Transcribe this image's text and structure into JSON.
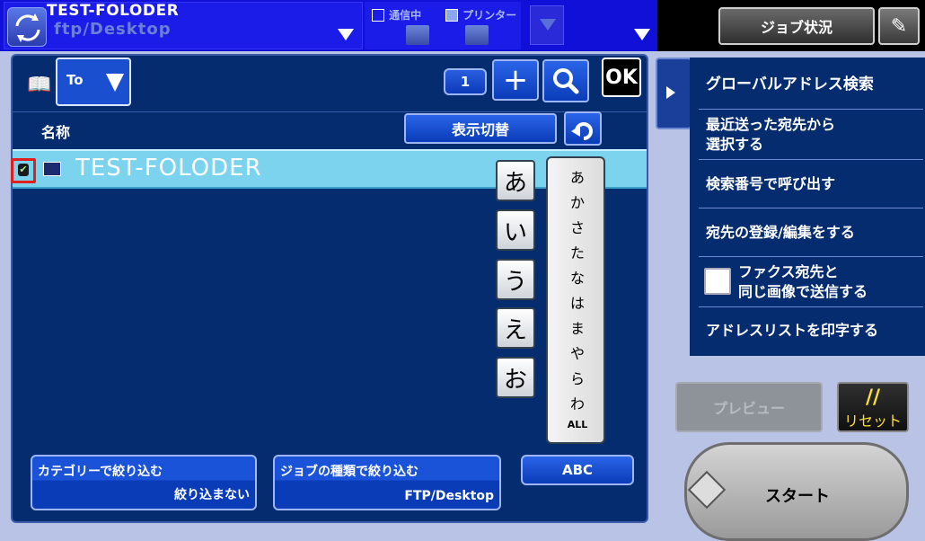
{
  "header": {
    "destination_title": "TEST-FOLODER",
    "destination_sub": "ftp/Desktop",
    "status_comm": "通信中",
    "status_printer": "プリンター",
    "job_status_label": "ジョブ状況"
  },
  "toolbar": {
    "to_label": "To",
    "count": "1",
    "ok_label": "OK"
  },
  "list": {
    "col_name": "名称",
    "view_toggle_label": "表示切替",
    "rows": [
      {
        "name": "TEST-FOLODER",
        "selected": true
      }
    ]
  },
  "kana": {
    "vowel_keys": [
      "あ",
      "い",
      "う",
      "え",
      "お"
    ],
    "row_keys": [
      "あ",
      "か",
      "さ",
      "た",
      "な",
      "は",
      "ま",
      "や",
      "ら",
      "わ",
      "ALL"
    ]
  },
  "filters": {
    "category": {
      "title": "カテゴリーで絞り込む",
      "value": "絞り込まない"
    },
    "job_type": {
      "title": "ジョブの種類で絞り込む",
      "value": "FTP/Desktop"
    },
    "abc_label": "ABC"
  },
  "side_menu": {
    "items": [
      "グローバルアドレス検索",
      "最近送った宛先から\n選択する",
      "検索番号で呼び出す",
      "宛先の登録/編集をする",
      "ファクス宛先と\n同じ画像で送信する",
      "アドレスリストを印字する"
    ]
  },
  "actions": {
    "preview_label": "プレビュー",
    "reset_label": "リセット",
    "start_label": "スタート"
  },
  "colors": {
    "panel": "#052c6e",
    "selected_row": "#7bd3ee",
    "top_bar": "#1010d8"
  }
}
